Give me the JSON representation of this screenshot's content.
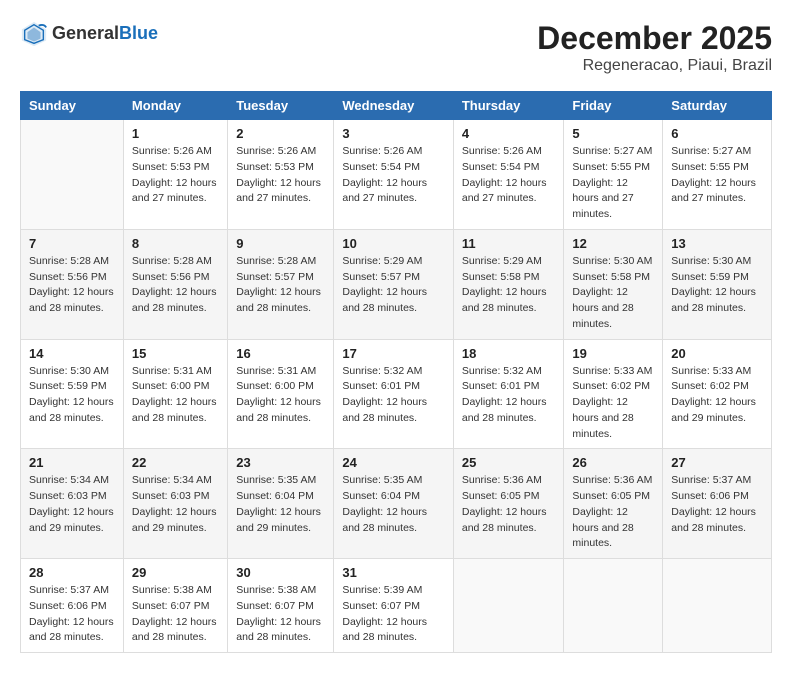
{
  "header": {
    "logo_general": "General",
    "logo_blue": "Blue",
    "month_title": "December 2025",
    "location": "Regeneracao, Piaui, Brazil"
  },
  "columns": [
    "Sunday",
    "Monday",
    "Tuesday",
    "Wednesday",
    "Thursday",
    "Friday",
    "Saturday"
  ],
  "weeks": [
    {
      "days": [
        {
          "num": "",
          "sunrise": "",
          "sunset": "",
          "daylight": ""
        },
        {
          "num": "1",
          "sunrise": "Sunrise: 5:26 AM",
          "sunset": "Sunset: 5:53 PM",
          "daylight": "Daylight: 12 hours and 27 minutes."
        },
        {
          "num": "2",
          "sunrise": "Sunrise: 5:26 AM",
          "sunset": "Sunset: 5:53 PM",
          "daylight": "Daylight: 12 hours and 27 minutes."
        },
        {
          "num": "3",
          "sunrise": "Sunrise: 5:26 AM",
          "sunset": "Sunset: 5:54 PM",
          "daylight": "Daylight: 12 hours and 27 minutes."
        },
        {
          "num": "4",
          "sunrise": "Sunrise: 5:26 AM",
          "sunset": "Sunset: 5:54 PM",
          "daylight": "Daylight: 12 hours and 27 minutes."
        },
        {
          "num": "5",
          "sunrise": "Sunrise: 5:27 AM",
          "sunset": "Sunset: 5:55 PM",
          "daylight": "Daylight: 12 hours and 27 minutes."
        },
        {
          "num": "6",
          "sunrise": "Sunrise: 5:27 AM",
          "sunset": "Sunset: 5:55 PM",
          "daylight": "Daylight: 12 hours and 27 minutes."
        }
      ]
    },
    {
      "days": [
        {
          "num": "7",
          "sunrise": "Sunrise: 5:28 AM",
          "sunset": "Sunset: 5:56 PM",
          "daylight": "Daylight: 12 hours and 28 minutes."
        },
        {
          "num": "8",
          "sunrise": "Sunrise: 5:28 AM",
          "sunset": "Sunset: 5:56 PM",
          "daylight": "Daylight: 12 hours and 28 minutes."
        },
        {
          "num": "9",
          "sunrise": "Sunrise: 5:28 AM",
          "sunset": "Sunset: 5:57 PM",
          "daylight": "Daylight: 12 hours and 28 minutes."
        },
        {
          "num": "10",
          "sunrise": "Sunrise: 5:29 AM",
          "sunset": "Sunset: 5:57 PM",
          "daylight": "Daylight: 12 hours and 28 minutes."
        },
        {
          "num": "11",
          "sunrise": "Sunrise: 5:29 AM",
          "sunset": "Sunset: 5:58 PM",
          "daylight": "Daylight: 12 hours and 28 minutes."
        },
        {
          "num": "12",
          "sunrise": "Sunrise: 5:30 AM",
          "sunset": "Sunset: 5:58 PM",
          "daylight": "Daylight: 12 hours and 28 minutes."
        },
        {
          "num": "13",
          "sunrise": "Sunrise: 5:30 AM",
          "sunset": "Sunset: 5:59 PM",
          "daylight": "Daylight: 12 hours and 28 minutes."
        }
      ]
    },
    {
      "days": [
        {
          "num": "14",
          "sunrise": "Sunrise: 5:30 AM",
          "sunset": "Sunset: 5:59 PM",
          "daylight": "Daylight: 12 hours and 28 minutes."
        },
        {
          "num": "15",
          "sunrise": "Sunrise: 5:31 AM",
          "sunset": "Sunset: 6:00 PM",
          "daylight": "Daylight: 12 hours and 28 minutes."
        },
        {
          "num": "16",
          "sunrise": "Sunrise: 5:31 AM",
          "sunset": "Sunset: 6:00 PM",
          "daylight": "Daylight: 12 hours and 28 minutes."
        },
        {
          "num": "17",
          "sunrise": "Sunrise: 5:32 AM",
          "sunset": "Sunset: 6:01 PM",
          "daylight": "Daylight: 12 hours and 28 minutes."
        },
        {
          "num": "18",
          "sunrise": "Sunrise: 5:32 AM",
          "sunset": "Sunset: 6:01 PM",
          "daylight": "Daylight: 12 hours and 28 minutes."
        },
        {
          "num": "19",
          "sunrise": "Sunrise: 5:33 AM",
          "sunset": "Sunset: 6:02 PM",
          "daylight": "Daylight: 12 hours and 28 minutes."
        },
        {
          "num": "20",
          "sunrise": "Sunrise: 5:33 AM",
          "sunset": "Sunset: 6:02 PM",
          "daylight": "Daylight: 12 hours and 29 minutes."
        }
      ]
    },
    {
      "days": [
        {
          "num": "21",
          "sunrise": "Sunrise: 5:34 AM",
          "sunset": "Sunset: 6:03 PM",
          "daylight": "Daylight: 12 hours and 29 minutes."
        },
        {
          "num": "22",
          "sunrise": "Sunrise: 5:34 AM",
          "sunset": "Sunset: 6:03 PM",
          "daylight": "Daylight: 12 hours and 29 minutes."
        },
        {
          "num": "23",
          "sunrise": "Sunrise: 5:35 AM",
          "sunset": "Sunset: 6:04 PM",
          "daylight": "Daylight: 12 hours and 29 minutes."
        },
        {
          "num": "24",
          "sunrise": "Sunrise: 5:35 AM",
          "sunset": "Sunset: 6:04 PM",
          "daylight": "Daylight: 12 hours and 28 minutes."
        },
        {
          "num": "25",
          "sunrise": "Sunrise: 5:36 AM",
          "sunset": "Sunset: 6:05 PM",
          "daylight": "Daylight: 12 hours and 28 minutes."
        },
        {
          "num": "26",
          "sunrise": "Sunrise: 5:36 AM",
          "sunset": "Sunset: 6:05 PM",
          "daylight": "Daylight: 12 hours and 28 minutes."
        },
        {
          "num": "27",
          "sunrise": "Sunrise: 5:37 AM",
          "sunset": "Sunset: 6:06 PM",
          "daylight": "Daylight: 12 hours and 28 minutes."
        }
      ]
    },
    {
      "days": [
        {
          "num": "28",
          "sunrise": "Sunrise: 5:37 AM",
          "sunset": "Sunset: 6:06 PM",
          "daylight": "Daylight: 12 hours and 28 minutes."
        },
        {
          "num": "29",
          "sunrise": "Sunrise: 5:38 AM",
          "sunset": "Sunset: 6:07 PM",
          "daylight": "Daylight: 12 hours and 28 minutes."
        },
        {
          "num": "30",
          "sunrise": "Sunrise: 5:38 AM",
          "sunset": "Sunset: 6:07 PM",
          "daylight": "Daylight: 12 hours and 28 minutes."
        },
        {
          "num": "31",
          "sunrise": "Sunrise: 5:39 AM",
          "sunset": "Sunset: 6:07 PM",
          "daylight": "Daylight: 12 hours and 28 minutes."
        },
        {
          "num": "",
          "sunrise": "",
          "sunset": "",
          "daylight": ""
        },
        {
          "num": "",
          "sunrise": "",
          "sunset": "",
          "daylight": ""
        },
        {
          "num": "",
          "sunrise": "",
          "sunset": "",
          "daylight": ""
        }
      ]
    }
  ]
}
